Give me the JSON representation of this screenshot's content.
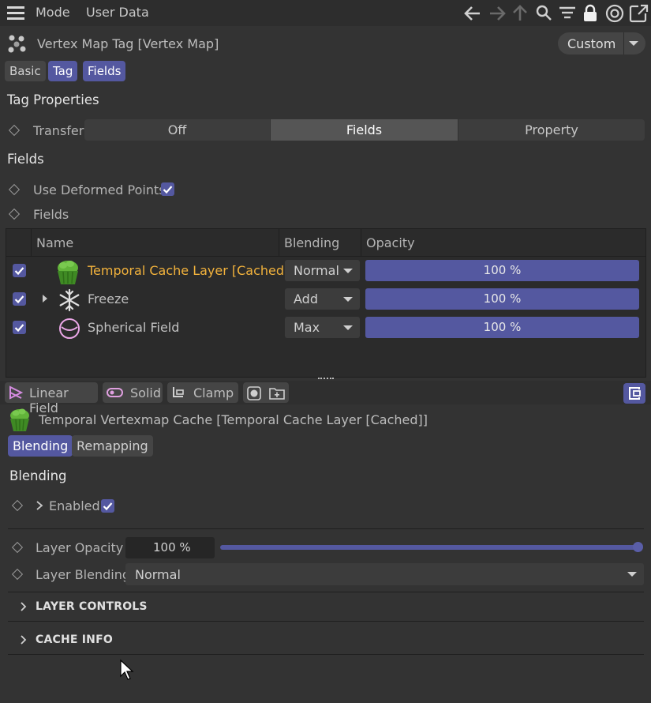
{
  "menubar": {
    "mode": "Mode",
    "user_data": "User Data"
  },
  "header": {
    "title": "Vertex Map Tag [Vertex Map]",
    "preset": "Custom"
  },
  "tabs": [
    "Basic",
    "Tag",
    "Fields"
  ],
  "tag_properties": {
    "title": "Tag Properties",
    "transfer_label": "Transfer",
    "transfer_options": [
      "Off",
      "Fields",
      "Property"
    ],
    "transfer_selected": "Fields"
  },
  "fields_section": {
    "title": "Fields",
    "use_deformed_label": "Use Deformed Points",
    "use_deformed_checked": true,
    "fields_label": "Fields",
    "columns": {
      "name": "Name",
      "blending": "Blending",
      "opacity": "Opacity"
    },
    "rows": [
      {
        "name": "Temporal Cache Layer [Cached]",
        "blending": "Normal",
        "opacity": "100 %",
        "icon": "cupcake-icon",
        "checked": true
      },
      {
        "name": "Freeze",
        "blending": "Add",
        "opacity": "100 %",
        "icon": "snowflake-icon",
        "checked": true
      },
      {
        "name": "Spherical Field",
        "blending": "Max",
        "opacity": "100 %",
        "icon": "sphere-icon",
        "checked": true
      }
    ]
  },
  "layer_toolbar": {
    "linear_field": "Linear Field",
    "solid": "Solid",
    "clamp": "Clamp"
  },
  "layer": {
    "title": "Temporal Vertexmap Cache [Temporal Cache Layer [Cached]]",
    "tabs": [
      "Blending",
      "Remapping"
    ],
    "blending_title": "Blending",
    "enabled_label": "Enabled",
    "enabled_checked": true,
    "opacity_label": "Layer Opacity",
    "opacity_value": "100 %",
    "opacity_fraction": 1.0,
    "blending_label": "Layer Blending",
    "blending_value": "Normal",
    "groups": [
      "LAYER CONTROLS",
      "CACHE INFO"
    ]
  },
  "colors": {
    "accent": "#5458a0",
    "highlight_name": "#f2b23c",
    "cupcake_green": "#4fa02e",
    "sphere_pink": "#e9a6e6"
  }
}
